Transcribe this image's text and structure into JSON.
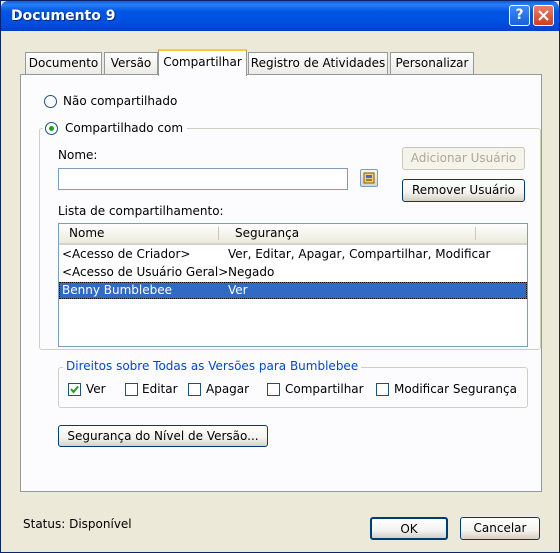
{
  "window": {
    "title": "Documento 9"
  },
  "tabs": [
    {
      "label": "Documento"
    },
    {
      "label": "Versão"
    },
    {
      "label": "Compartilhar"
    },
    {
      "label": "Registro de Atividades"
    },
    {
      "label": "Personalizar"
    }
  ],
  "sharing": {
    "not_shared_label": "Não compartilhado",
    "shared_with_label": "Compartilhado com",
    "selected_option": "Compartilhado com",
    "name_label": "Nome:",
    "name_value": "",
    "add_user_button": "Adicionar Usuário",
    "remove_user_button": "Remover Usuário",
    "list_label": "Lista de compartilhamento:",
    "list_columns": [
      "Nome",
      "Segurança"
    ],
    "list_rows": [
      {
        "name": "<Acesso de Criador>",
        "security": "Ver, Editar, Apagar, Compartilhar, Modificar"
      },
      {
        "name": "<Acesso de Usuário Geral>",
        "security": "Negado"
      },
      {
        "name": "Benny Bumblebee",
        "security": "Ver",
        "selected": true
      }
    ]
  },
  "rights": {
    "group_title": "Direitos sobre Todas as Versões para Bumblebee",
    "options": [
      {
        "label": "Ver",
        "checked": true
      },
      {
        "label": "Editar",
        "checked": false
      },
      {
        "label": "Apagar",
        "checked": false
      },
      {
        "label": "Compartilhar",
        "checked": false
      },
      {
        "label": "Modificar Segurança",
        "checked": false
      }
    ]
  },
  "version_security_button": "Segurança do Nível de Versão...",
  "status": {
    "text": "Status: Disponível"
  },
  "footer": {
    "ok_label": "OK",
    "cancel_label": "Cancelar"
  },
  "colors": {
    "title_bar": "#0055e5",
    "selection": "#316ac5",
    "radio_dot": "#21a121"
  }
}
